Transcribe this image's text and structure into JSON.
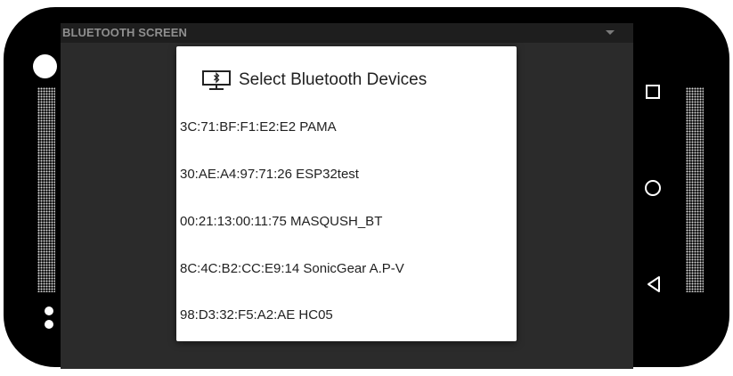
{
  "app": {
    "title": "BLUETOOTH SCREEN"
  },
  "dialog": {
    "title": "Select Bluetooth Devices",
    "icon": "bluetooth-device-icon",
    "devices": [
      "3C:71:BF:F1:E2:E2 PAMA",
      "30:AE:A4:97:71:26 ESP32test",
      "00:21:13:00:11:75 MASQUSH_BT",
      "8C:4C:B2:CC:E9:14 SonicGear A.P-V",
      "98:D3:32:F5:A2:AE HC05"
    ]
  },
  "navigation": {
    "buttons": [
      "recents-icon",
      "home-icon",
      "back-icon"
    ]
  },
  "colors": {
    "phone_body": "#000000",
    "screen_background": "#2b2b2b",
    "title_bar": "#1e1e1e",
    "title_text": "#8f8f8f",
    "dialog_background": "#ffffff"
  }
}
